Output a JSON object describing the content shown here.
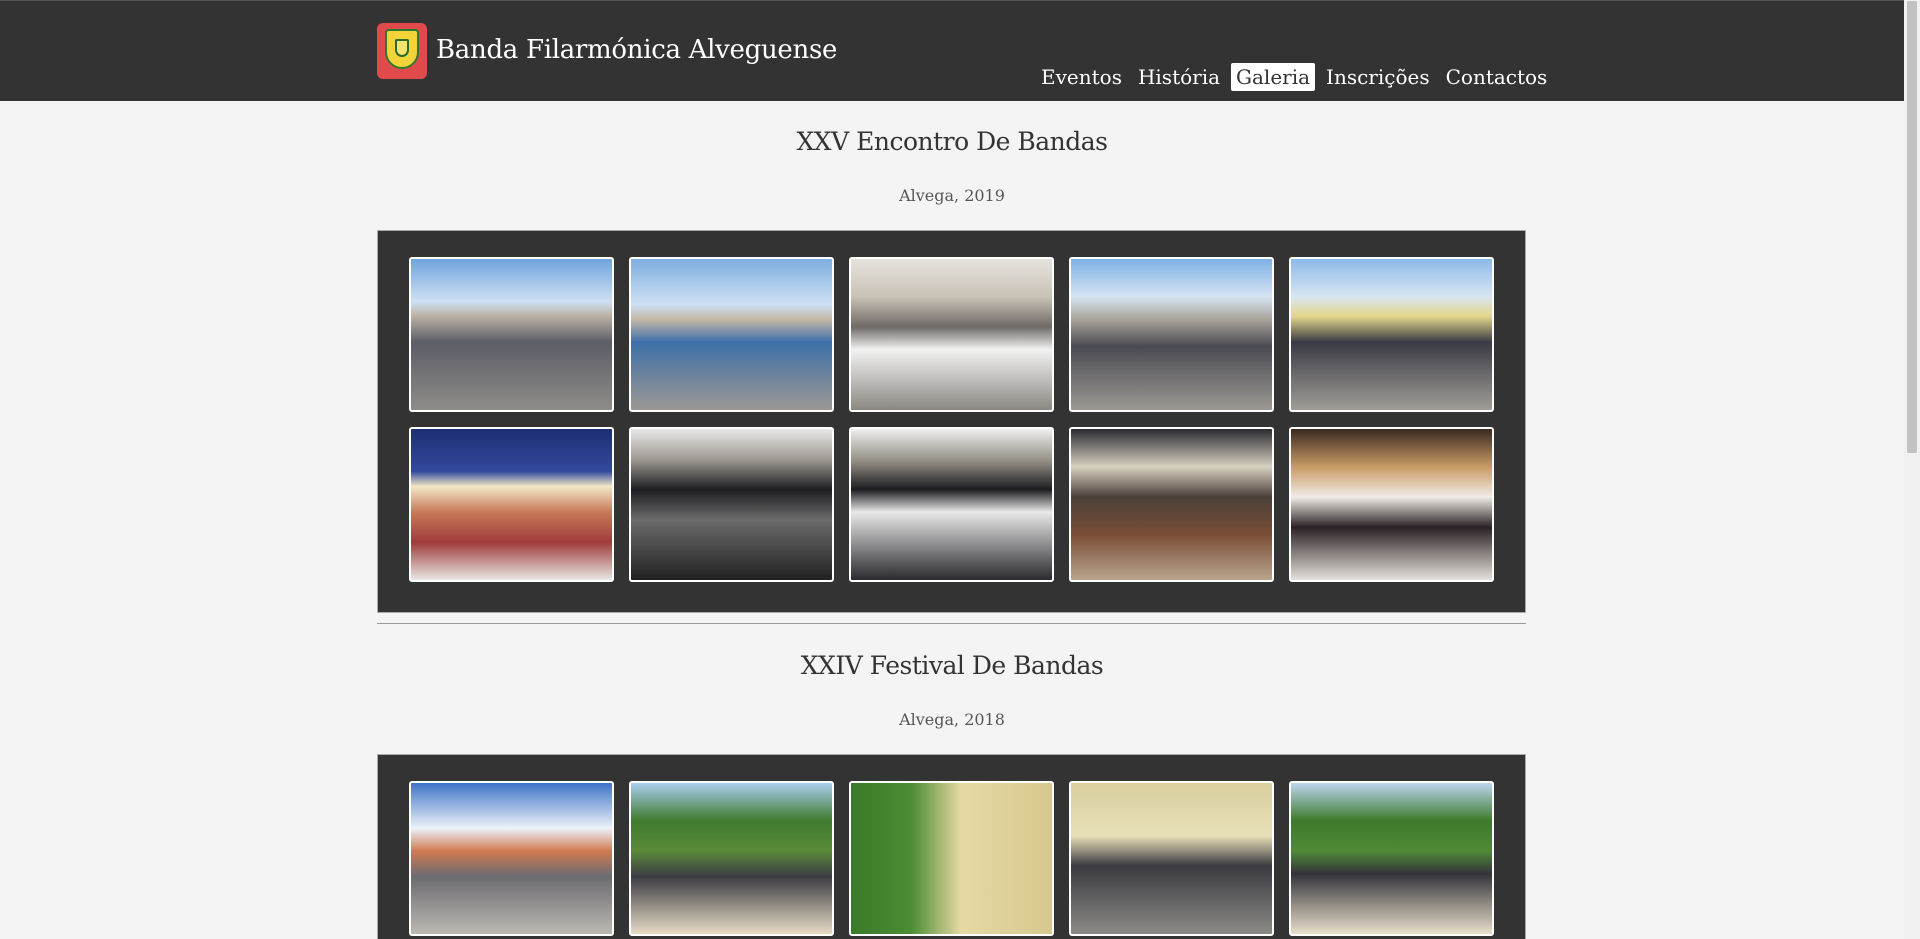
{
  "header": {
    "logo_name": "coat-of-arms-logo",
    "site_title": "Banda Filarmónica Alveguense",
    "nav": [
      {
        "label": "Eventos",
        "active": false
      },
      {
        "label": "História",
        "active": false
      },
      {
        "label": "Galeria",
        "active": true
      },
      {
        "label": "Inscrições",
        "active": false
      },
      {
        "label": "Contactos",
        "active": false
      }
    ]
  },
  "sections": [
    {
      "title": "XXV Encontro De Bandas",
      "subtitle": "Alvega, 2019",
      "photos": [
        {
          "scene": "outdoor-daytime-band-parade"
        },
        {
          "scene": "outdoor-daytime-band-in-blue-shirts"
        },
        {
          "scene": "outdoor-daytime-musicians-with-music-stands"
        },
        {
          "scene": "outdoor-daytime-clarinet-player"
        },
        {
          "scene": "outdoor-daytime-drummers-marching"
        },
        {
          "scene": "night-bandstand-crowd"
        },
        {
          "scene": "night-concert-under-canopy"
        },
        {
          "scene": "night-concert-sheet-music"
        },
        {
          "scene": "night-concert-timpani"
        },
        {
          "scene": "night-concert-musicians-standing"
        }
      ]
    },
    {
      "title": "XXIV Festival De Bandas",
      "subtitle": "Alvega, 2018",
      "photos": [
        {
          "scene": "outdoor-bandstand-with-banners"
        },
        {
          "scene": "outdoor-band-under-trees"
        },
        {
          "scene": "outdoor-band-near-school-building"
        },
        {
          "scene": "outdoor-band-seated-near-building"
        },
        {
          "scene": "outdoor-band-on-sand-under-trees"
        }
      ]
    }
  ],
  "colors": {
    "header_bg": "#333333",
    "page_bg": "#f4f4f4",
    "gallery_bg": "#333333",
    "logo_red": "#e04a4a",
    "logo_yellow": "#f2d43a"
  }
}
